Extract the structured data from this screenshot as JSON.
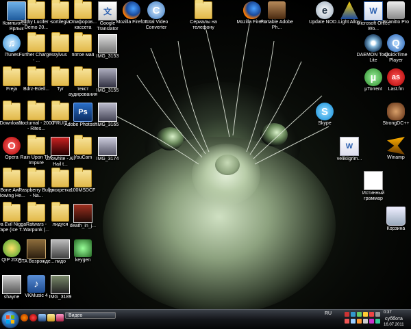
{
  "desktop_icons": {
    "computer": "Компьютер - Ярлык",
    "filthy": "Filthy Lucifer - Demo 20...",
    "sortilegia": "sortilegia",
    "opiforov": "Опифоров... кассета",
    "google_translator": "Google Translator",
    "firefox1": "Mozilla Firefox",
    "total_video": "Total Video Converter",
    "serials": "Сериалы на телефону",
    "firefox2": "Mozilla Firefox",
    "portable_adobe": "Portable Adobe Ph...",
    "update_nod": "Update NOD...",
    "light_alloy": "Light Alloy",
    "ms_office": "Microsoft Office Wo...",
    "scanitto": "Scanitto Pro",
    "itunes": "iTunes",
    "further_charges": "Further Charges - ...",
    "sylvus": "sylvus",
    "pyatoe_maya": "пятое мая",
    "img3153": "IMG_3153",
    "daemon": "DAEMON Tools Lite",
    "quicktime": "QuickTime Player",
    "freja": "Freja",
    "edell": "Bdrz-Edell...",
    "tyr": "Tyr",
    "tekst": "текст аудирования",
    "img3155": "IMG_3155",
    "utorrent": "µTorrent",
    "lastfm": "Last.fm",
    "downloads": "Downloads",
    "nocturnal": "Nocturnal - 2000 - Rites...",
    "fruit": "FRUIT",
    "photoshop": "Adobe Photosh...",
    "img3165": "IMG_3165",
    "skype": "Skype",
    "strongdc": "StrongDC++",
    "opera": "Opera",
    "rain": "Rain Upon The Impure",
    "znowhite": "Znowhite - All Hail t...",
    "youcam": "YouCam",
    "img3174": "IMG_3174",
    "velikiigrim": "velikiigrim...",
    "winamp": "Winamp",
    "bone_awl": "Bone Awl - Bowing He...",
    "raspberry": "Raspberry Bulbs - Na...",
    "diskretka": "дискретка",
    "msdcf": "100MSDCF",
    "istinnyi": "Истинный граммар",
    "da_evil": "Da Evil Nigga Tape (Ice T...",
    "ratwars": "Ratwars - Warpunk (...",
    "lidusya": "лидуся",
    "death": "death_in_j...",
    "korzina": "Корзина",
    "qip": "QIP 2005",
    "gta": "GTA Возрожде...",
    "lido": "лидо",
    "keygen": "keygen",
    "shayne": "shayne",
    "vkmusic": "VKMusic 4",
    "img3189": "IMG_3189"
  },
  "taskbar": {
    "window_button": "Видео",
    "language": "RU",
    "time": "0:37",
    "day": "суббота",
    "date": "16.07.2011"
  },
  "colors": {
    "folder": "#e9c55a",
    "taskbar": "#14161a",
    "cat_glow": "#b9cda9"
  }
}
